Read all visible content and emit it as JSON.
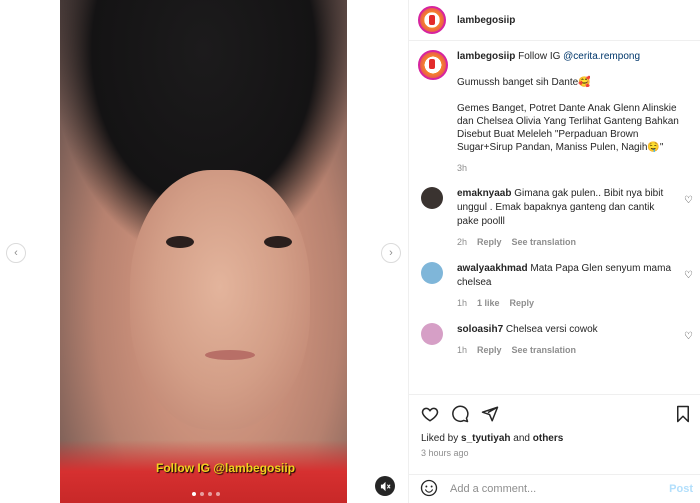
{
  "media": {
    "watermark": "Follow IG @lambegosiip",
    "dots": [
      true,
      false,
      false,
      false
    ]
  },
  "header": {
    "username": "lambegosiip"
  },
  "caption": {
    "username": "lambegosiip",
    "lead": "Follow IG",
    "mention": "@cerita.rempong",
    "line1": "Gumussh banget sih Dante🥰",
    "line2": "Gemes Banget, Potret Dante Anak Glenn Alinskie dan Chelsea Olivia Yang Terlihat Ganteng Bahkan Disebut Buat Meleleh \"Perpaduan Brown Sugar+Sirup Pandan, Maniss Pulen, Nagih🤤\"",
    "time": "3h"
  },
  "comments": [
    {
      "username": "emaknyaab",
      "text": "Gimana gak pulen.. Bibit nya bibit unggul . Emak bapaknya ganteng dan cantik pake poolll",
      "time": "2h",
      "likes": "",
      "reply": "Reply",
      "translate": "See translation",
      "avatar_color": "#3a3330"
    },
    {
      "username": "awalyaakhmad",
      "text": "Mata Papa Glen senyum mama chelsea",
      "time": "1h",
      "likes": "1 like",
      "reply": "Reply",
      "translate": "",
      "avatar_color": "#7fb6d9"
    },
    {
      "username": "soloasih7",
      "text": "Chelsea versi cowok",
      "time": "1h",
      "likes": "",
      "reply": "Reply",
      "translate": "See translation",
      "avatar_color": "#d69fc6"
    }
  ],
  "likes": {
    "prefix": "Liked by",
    "user": "s_tyutiyah",
    "and": "and",
    "others": "others"
  },
  "posted_ago": "3 hours ago",
  "add_comment": {
    "placeholder": "Add a comment...",
    "post_label": "Post"
  }
}
